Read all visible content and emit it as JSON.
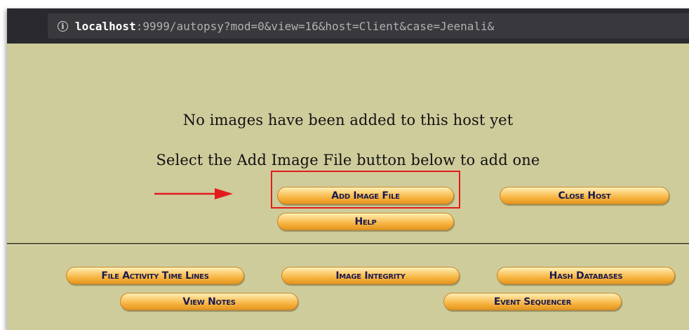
{
  "address_bar": {
    "host": "localhost",
    "rest": ":9999/autopsy?mod=0&view=16&host=Client&case=Jeenali&"
  },
  "page": {
    "message_line1": "No images have been added to this host yet",
    "message_line2": "Select the Add Image File button below to add one"
  },
  "buttons": {
    "add_image_file": "Add Image File",
    "close_host": "Close Host",
    "help": "Help",
    "file_activity_time_lines": "File Activity Time Lines",
    "image_integrity": "Image Integrity",
    "hash_databases": "Hash Databases",
    "view_notes": "View Notes",
    "event_sequencer": "Event Sequencer"
  },
  "colors": {
    "page_background": "#cfcc9c",
    "button_gradient": [
      "#fff0b8",
      "#f6b23e"
    ],
    "button_text": "#1a1a50",
    "annotation_red": "#e21c1c"
  },
  "icons": {
    "info": "info-circle-icon",
    "arrow": "right-arrow-annotation"
  }
}
